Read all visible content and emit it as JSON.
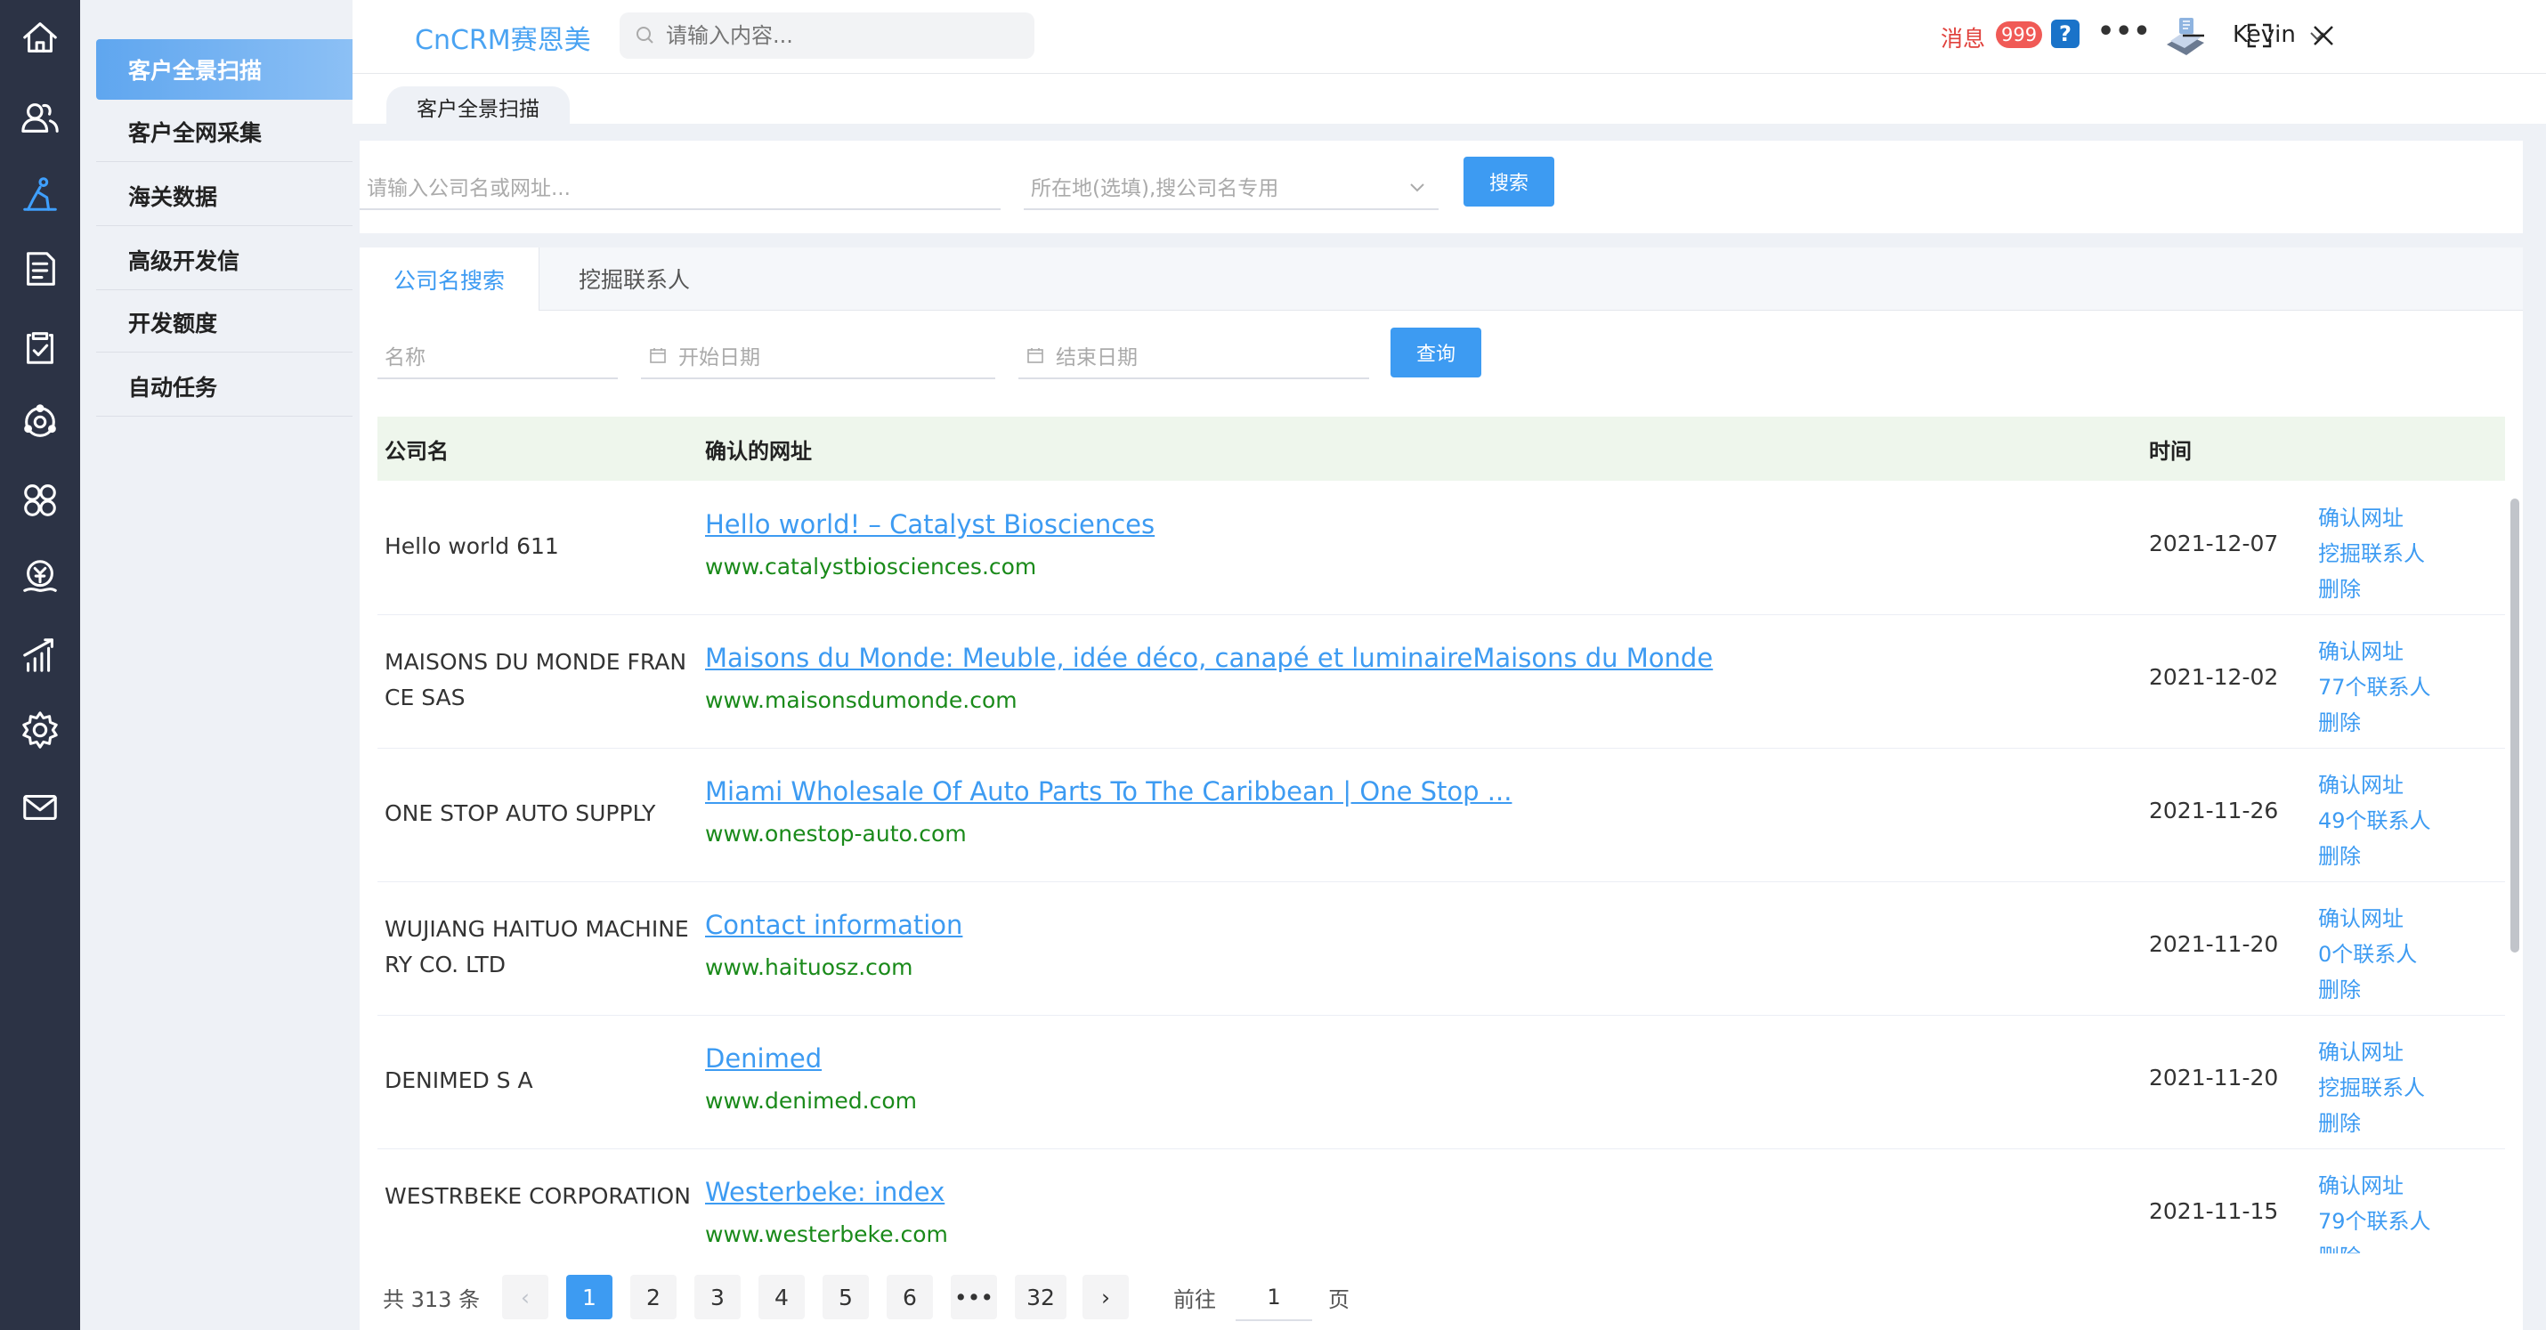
{
  "app": {
    "brand": "CnCRM赛恩美"
  },
  "search": {
    "placeholder": "请输入内容..."
  },
  "header": {
    "msg_label": "消息",
    "msg_count": "999",
    "help": "?",
    "more": "•••",
    "user_name": "Kevin"
  },
  "rail": {
    "icons": [
      "home-icon",
      "customers-icon",
      "scan-icon",
      "document-icon",
      "clipboard-icon",
      "orbit-icon",
      "apps-icon",
      "finance-icon",
      "stats-icon",
      "settings-icon",
      "mail-icon"
    ],
    "active": "scan-icon",
    "accent": "#3fa0ff"
  },
  "submenu": {
    "items": [
      "客户全景扫描",
      "客户全网采集",
      "海关数据",
      "高级开发信",
      "开发额度",
      "自动任务"
    ],
    "active_index": 0
  },
  "page_tab": "客户全景扫描",
  "top_search": {
    "company_placeholder": "请输入公司名或网址...",
    "location_placeholder": "所在地(选填),搜公司名专用",
    "button": "搜索"
  },
  "tabs": {
    "items": [
      "公司名搜索",
      "挖掘联系人"
    ],
    "active_index": 0
  },
  "filters": {
    "name_placeholder": "名称",
    "start_placeholder": "开始日期",
    "end_placeholder": "结束日期",
    "button": "查询"
  },
  "table": {
    "headers": {
      "company": "公司名",
      "site": "确认的网址",
      "time": "时间"
    },
    "rows": [
      {
        "company": "Hello world 611",
        "title": "Hello world! – Catalyst Biosciences",
        "url": "www.catalystbiosciences.com",
        "time": "2021-12-07",
        "actions": [
          "确认网址",
          "挖掘联系人",
          "删除"
        ]
      },
      {
        "company": "MAISONS DU MONDE FRANCE SAS",
        "title": "Maisons du Monde: Meuble, idée déco, canapé et luminaireMaisons du Monde",
        "url": "www.maisonsdumonde.com",
        "time": "2021-12-02",
        "actions": [
          "确认网址",
          "77个联系人",
          "删除"
        ]
      },
      {
        "company": "ONE STOP AUTO SUPPLY",
        "title": "Miami Wholesale Of Auto Parts To The Caribbean | One Stop ...",
        "url": "www.onestop-auto.com",
        "time": "2021-11-26",
        "actions": [
          "确认网址",
          "49个联系人",
          "删除"
        ]
      },
      {
        "company": "WUJIANG HAITUO MACHINERY CO. LTD",
        "title": "Contact information",
        "url": "www.haituosz.com",
        "time": "2021-11-20",
        "actions": [
          "确认网址",
          "0个联系人",
          "删除"
        ]
      },
      {
        "company": "DENIMED S A",
        "title": "Denimed",
        "url": "www.denimed.com",
        "time": "2021-11-20",
        "actions": [
          "确认网址",
          "挖掘联系人",
          "删除"
        ]
      },
      {
        "company": "WESTRBEKE CORPORATION",
        "title": "Westerbeke: index",
        "url": "www.westerbeke.com",
        "time": "2021-11-15",
        "actions": [
          "确认网址",
          "79个联系人",
          "删除"
        ]
      }
    ]
  },
  "pagination": {
    "total_text": "共 313 条",
    "prev": "‹",
    "next": "›",
    "pages": [
      "1",
      "2",
      "3",
      "4",
      "5",
      "6",
      "•••",
      "32"
    ],
    "active": "1",
    "goto_label": "前往",
    "goto_value": "1",
    "page_unit": "页"
  },
  "colors": {
    "primary": "#3d9bf2",
    "rail_bg": "#2c3345",
    "url_green": "#1a8a1a",
    "badge_red": "#f05a56"
  }
}
